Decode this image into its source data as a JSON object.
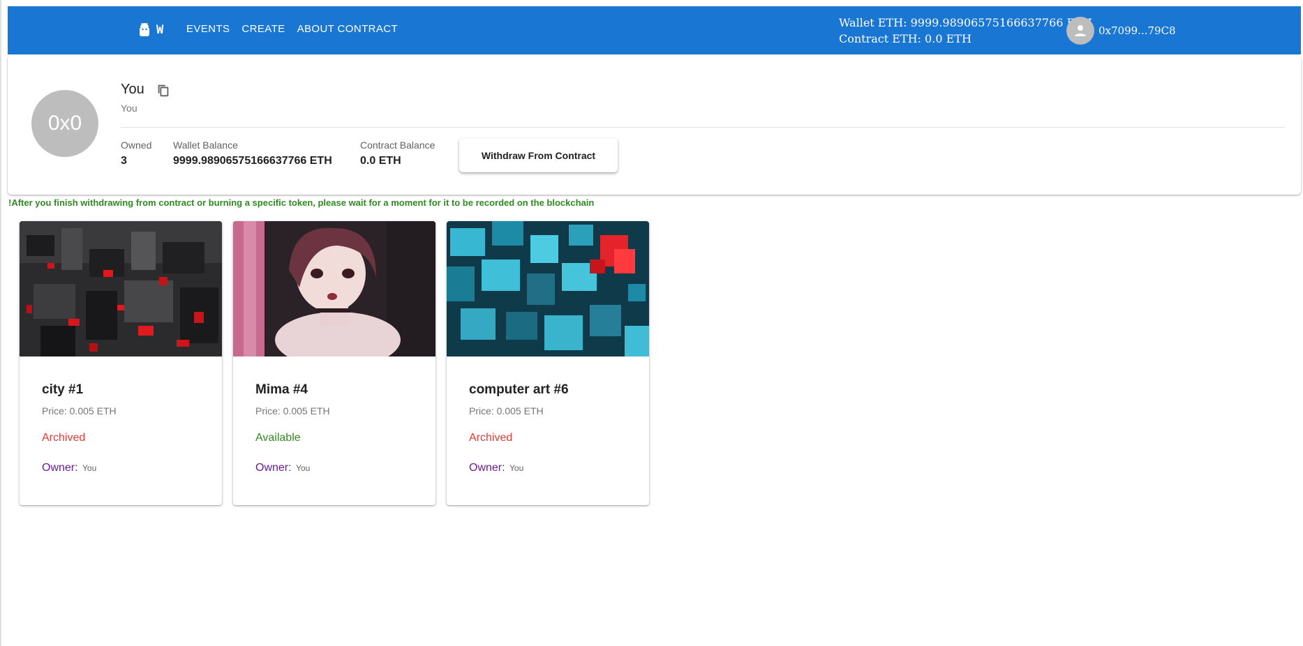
{
  "header": {
    "brand": "W",
    "brand_icon": "android-icon",
    "nav": [
      {
        "label": "EVENTS"
      },
      {
        "label": "CREATE"
      },
      {
        "label": "ABOUT CONTRACT"
      }
    ],
    "wallet_eth": "Wallet ETH: 9999.98906575166637766 ETH",
    "contract_eth": "Contract ETH: 0.0 ETH",
    "user_address": "0x7099...79C8",
    "accent_color": "#1976d2"
  },
  "profile": {
    "avatar_text": "0x0",
    "name": "You",
    "subtitle": "You",
    "stats": [
      {
        "label": "Owned",
        "value": "3"
      },
      {
        "label": "Wallet Balance",
        "value": "9999.98906575166637766 ETH"
      },
      {
        "label": "Contract Balance",
        "value": "0.0 ETH"
      }
    ],
    "withdraw_label": "Withdraw From Contract"
  },
  "notice": "!After you finish withdrawing from contract or burning a specific token, please wait for a moment for it to be recorded on the blockchain",
  "cards": [
    {
      "title": "city #1",
      "price": "Price: 0.005 ETH",
      "status": "Archived",
      "status_color": "#e53935",
      "owner_label": "Owner:",
      "owner": "You",
      "image": "red-black-city-blocks"
    },
    {
      "title": "Mima #4",
      "price": "Price: 0.005 ETH",
      "status": "Available",
      "status_color": "#2e8b1f",
      "owner_label": "Owner:",
      "owner": "You",
      "image": "anime-girl-portrait"
    },
    {
      "title": "computer art #6",
      "price": "Price: 0.005 ETH",
      "status": "Archived",
      "status_color": "#e53935",
      "owner_label": "Owner:",
      "owner": "You",
      "image": "cyan-3d-cubes"
    }
  ]
}
